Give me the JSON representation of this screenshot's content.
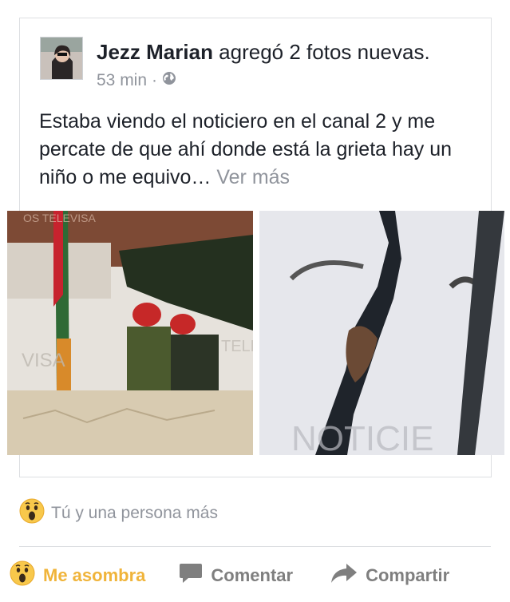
{
  "post": {
    "author": "Jezz Marian",
    "action": " agregó 2 fotos nuevas.",
    "time": "53 min",
    "separator": "·",
    "privacy_icon": "globe-icon",
    "text": "Estaba viendo el noticiero en el canal 2 y me percate de que ahí donde está la grieta hay un niño o me equivo…",
    "see_more": "Ver más",
    "photo1_watermark_top": "OS TELEVISA",
    "photo1_watermark_left": "VISA",
    "photo1_watermark_right": "TELE",
    "photo2_watermark": "NOTICIE"
  },
  "reactions": {
    "icon": "wow-reaction-icon",
    "text": "Tú y una persona más"
  },
  "actions": {
    "react_label": "Me asombra",
    "comment_label": "Comentar",
    "share_label": "Compartir"
  },
  "colors": {
    "border": "#dddfe2",
    "secondary_text": "#90949c",
    "wow_yellow": "#f0b43a"
  }
}
